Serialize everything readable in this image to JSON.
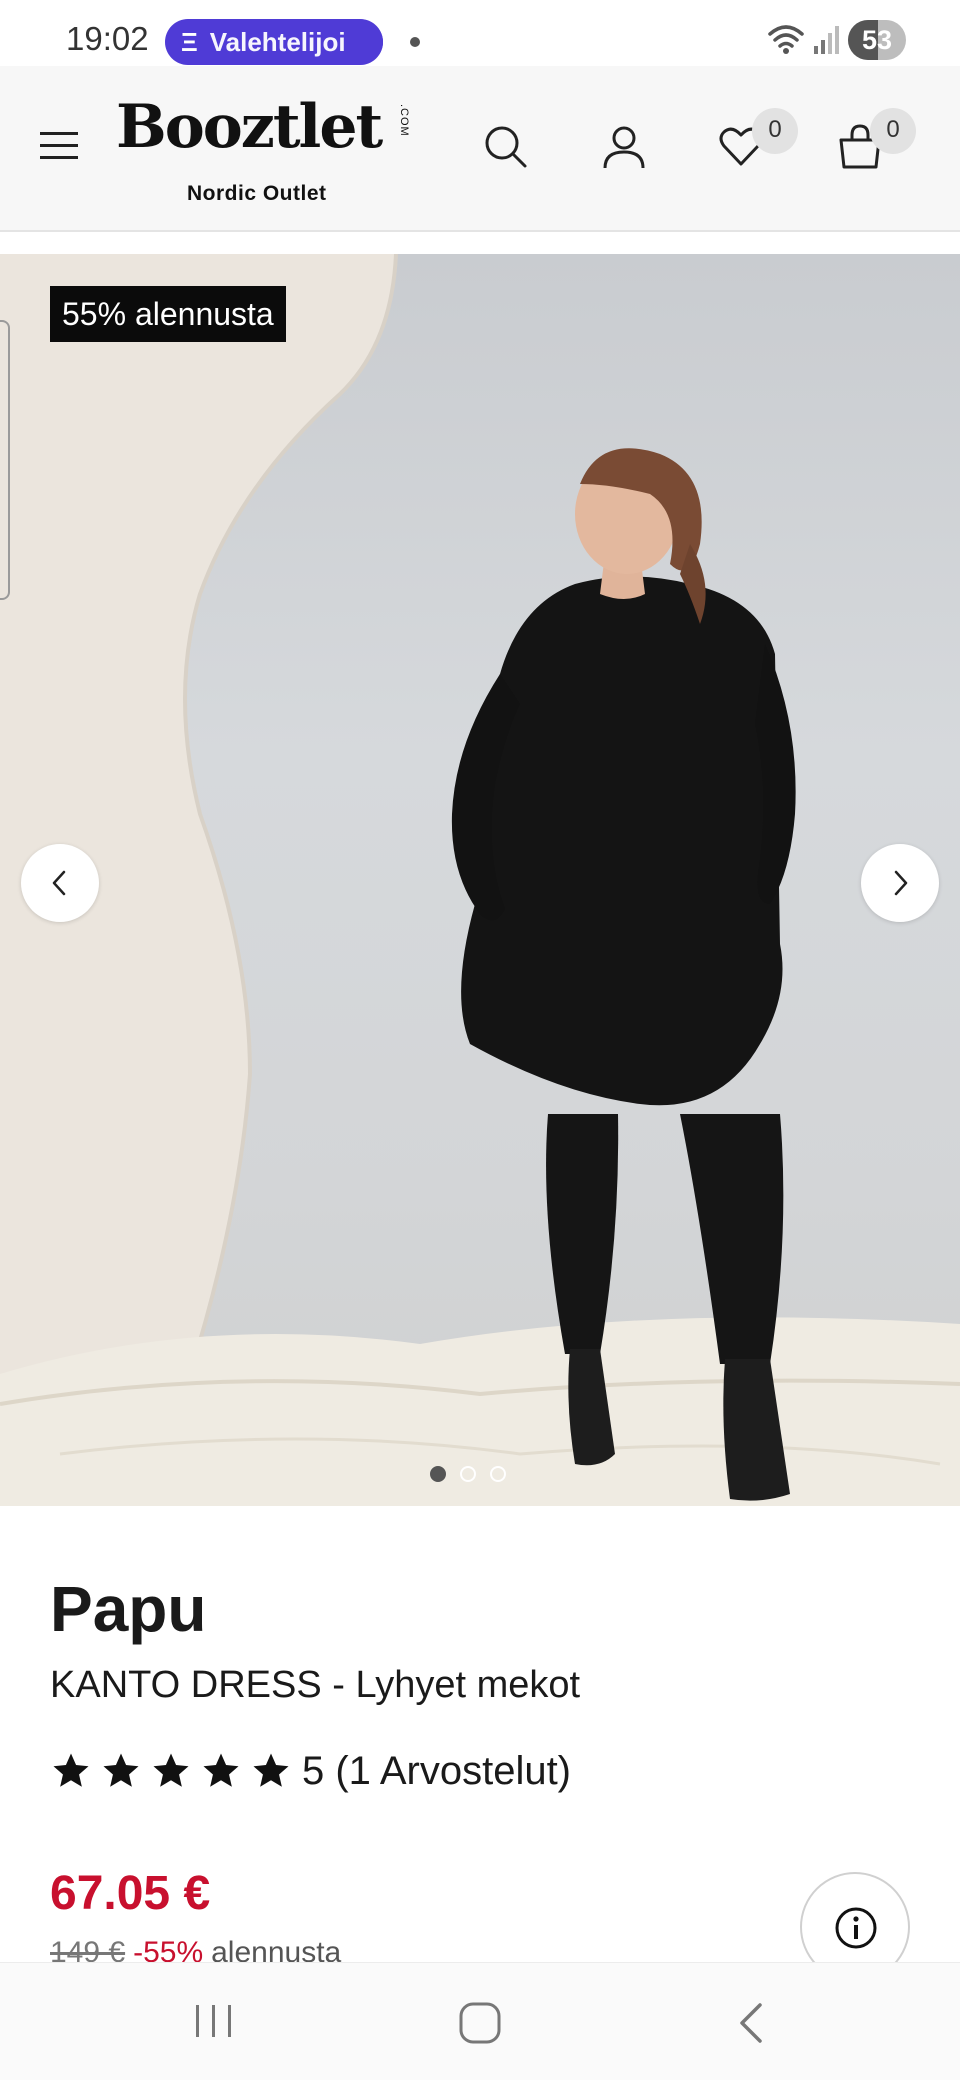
{
  "status_bar": {
    "time": "19:02",
    "notification_pill": "Valehtelijoi",
    "battery": "53",
    "icons": [
      "wifi-icon",
      "signal-icon",
      "battery-icon"
    ]
  },
  "header": {
    "logo_text": "Booztlet",
    "logo_com": ".COM",
    "logo_subtitle": "Nordic Outlet",
    "wishlist_count": "0",
    "cart_count": "0",
    "icons": [
      "menu-icon",
      "search-icon",
      "user-icon",
      "heart-icon",
      "bag-icon"
    ]
  },
  "gallery": {
    "discount_label": "55% alennusta",
    "active_index": 0,
    "image_count": 3,
    "image_description": "woman-black-dress"
  },
  "product": {
    "brand": "Papu",
    "title": "KANTO DRESS - Lyhyet mekot",
    "rating": 5,
    "rating_text": "5 (1 Arvostelut)",
    "price": "67.05 €",
    "old_price": "149 €",
    "discount_percent": "-55%",
    "discount_word": "alennusta"
  },
  "colors": {
    "accent_price": "#c8102e",
    "pill": "#4f3bd6",
    "tag_bg": "#0b0b0b"
  },
  "system_nav": [
    "recents-icon",
    "home-icon",
    "back-icon"
  ]
}
